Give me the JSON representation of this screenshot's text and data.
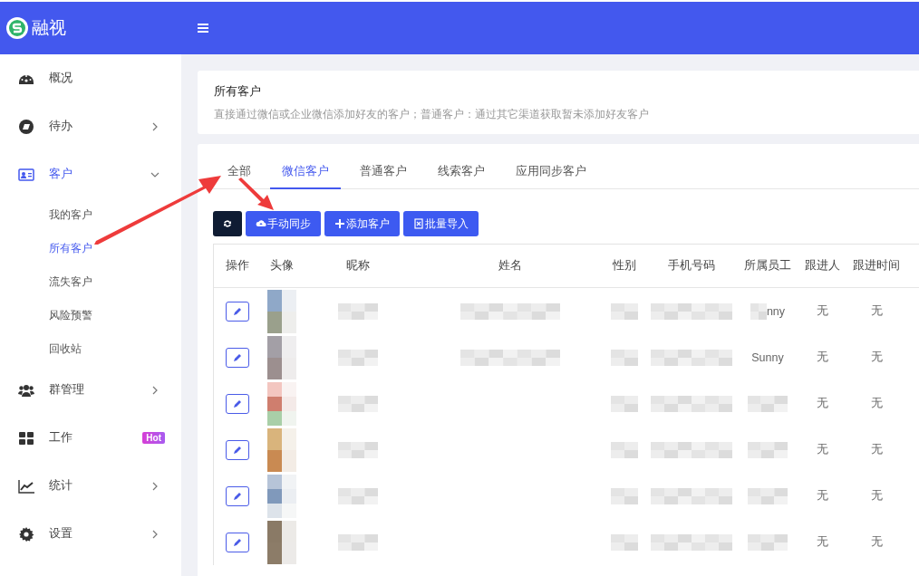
{
  "header": {
    "app_name": "融视"
  },
  "sidebar": {
    "items": [
      {
        "label": "概况",
        "selected": false
      },
      {
        "label": "待办",
        "selected": false,
        "expanded": false
      },
      {
        "label": "客户",
        "selected": true,
        "expanded": true,
        "children": [
          {
            "label": "我的客户",
            "selected": false
          },
          {
            "label": "所有客户",
            "selected": true
          },
          {
            "label": "流失客户",
            "selected": false
          },
          {
            "label": "风险预警",
            "selected": false
          },
          {
            "label": "回收站",
            "selected": false
          }
        ]
      },
      {
        "label": "群管理",
        "selected": false,
        "expanded": false
      },
      {
        "label": "工作",
        "selected": false,
        "badge": "Hot"
      },
      {
        "label": "统计",
        "selected": false,
        "expanded": false
      },
      {
        "label": "设置",
        "selected": false,
        "expanded": false
      }
    ]
  },
  "intro_card": {
    "title": "所有客户",
    "description": "直接通过微信或企业微信添加好友的客户；普通客户：通过其它渠道获取暂未添加好友客户"
  },
  "tabs": [
    {
      "label": "全部",
      "selected": false
    },
    {
      "label": "微信客户",
      "selected": true
    },
    {
      "label": "普通客户",
      "selected": false
    },
    {
      "label": "线索客户",
      "selected": false
    },
    {
      "label": "应用同步客户",
      "selected": false
    }
  ],
  "toolbar": [
    {
      "kind": "refresh"
    },
    {
      "kind": "sync",
      "label": "手动同步"
    },
    {
      "kind": "add",
      "label": "添加客户"
    },
    {
      "kind": "import",
      "label": "批量导入"
    }
  ],
  "table": {
    "columns": [
      "操作",
      "头像",
      "昵称",
      "姓名",
      "性别",
      "手机号码",
      "所属员工",
      "跟进人",
      "跟进时间"
    ],
    "rows": [
      {
        "nickname": {
          "kind": "mosaic"
        },
        "name": {
          "kind": "mosaic"
        },
        "gender": {
          "kind": "mosaic"
        },
        "phone": {
          "kind": "mosaic"
        },
        "staff": {
          "kind": "partly_hidden",
          "text": "nny"
        },
        "follower": {
          "kind": "text",
          "text": "无"
        },
        "follow_time": {
          "kind": "text",
          "text": "无"
        }
      },
      {
        "nickname": {
          "kind": "mosaic"
        },
        "name": {
          "kind": "mosaic"
        },
        "gender": {
          "kind": "mosaic"
        },
        "phone": {
          "kind": "mosaic"
        },
        "staff": {
          "kind": "text",
          "text": "Sunny"
        },
        "follower": {
          "kind": "text",
          "text": "无"
        },
        "follow_time": {
          "kind": "text",
          "text": "无"
        }
      },
      {
        "nickname": {
          "kind": "mosaic"
        },
        "gender": {
          "kind": "mosaic"
        },
        "phone": {
          "kind": "mosaic"
        },
        "staff": {
          "kind": "mosaic"
        },
        "follower": {
          "kind": "text",
          "text": "无"
        },
        "follow_time": {
          "kind": "text",
          "text": "无"
        }
      },
      {
        "nickname": {
          "kind": "mosaic"
        },
        "gender": {
          "kind": "mosaic"
        },
        "phone": {
          "kind": "mosaic"
        },
        "staff": {
          "kind": "mosaic"
        },
        "follower": {
          "kind": "text",
          "text": "无"
        },
        "follow_time": {
          "kind": "text",
          "text": "无"
        }
      },
      {
        "nickname": {
          "kind": "mosaic"
        },
        "gender": {
          "kind": "mosaic"
        },
        "phone": {
          "kind": "mosaic"
        },
        "staff": {
          "kind": "mosaic"
        },
        "follower": {
          "kind": "text",
          "text": "无"
        },
        "follow_time": {
          "kind": "text",
          "text": "无"
        }
      },
      {
        "nickname": {
          "kind": "mosaic"
        },
        "gender": {
          "kind": "mosaic"
        },
        "phone": {
          "kind": "mosaic"
        },
        "staff": {
          "kind": "mosaic"
        },
        "follower": {
          "kind": "text",
          "text": "无"
        },
        "follow_time": {
          "kind": "text",
          "text": "无"
        }
      }
    ]
  },
  "annotations": [
    {
      "kind": "arrow"
    },
    {
      "kind": "arrow"
    }
  ]
}
